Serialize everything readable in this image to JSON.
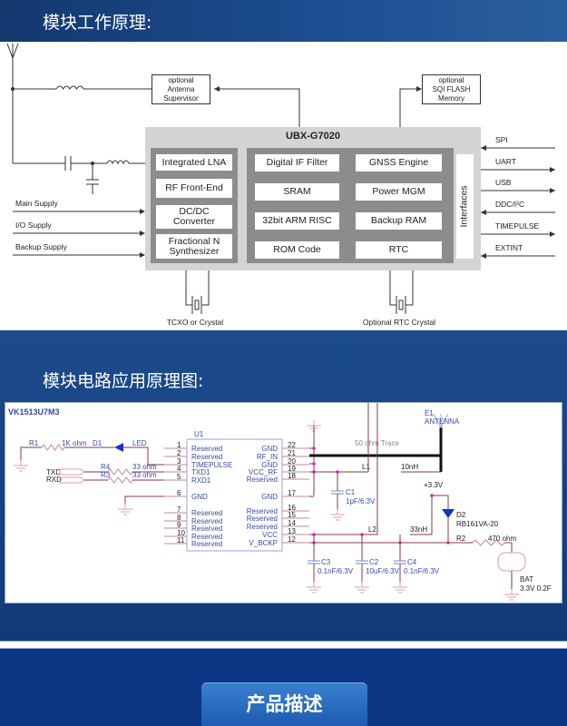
{
  "section1": {
    "title": "模块工作原理:"
  },
  "block_diagram": {
    "chip": "UBX-G7020",
    "antenna_supervisor": [
      "optional",
      "Antenna",
      "Supervisor"
    ],
    "flash": [
      "optional",
      "SQI FLASH",
      "Memory"
    ],
    "left_blocks": [
      "Integrated LNA",
      "RF Front-End",
      "DC/DC Converter",
      "Fractional N Synthesizer"
    ],
    "core_col1": [
      "Digital IF Filter",
      "SRAM",
      "32bit ARM RISC",
      "ROM Code"
    ],
    "core_col2": [
      "GNSS Engine",
      "Power MGM",
      "Backup RAM",
      "RTC"
    ],
    "interfaces": "Interfaces",
    "right_signals": [
      "SPI",
      "UART",
      "USB",
      "DDC/I²C",
      "TIMEPULSE",
      "EXTINT"
    ],
    "left_signals": [
      "Main Supply",
      "I/O Supply",
      "Backup Supply"
    ],
    "crystal1": "TCXO or Crystal",
    "crystal2": "Optional RTC Crystal"
  },
  "section2": {
    "title": "模块电路应用原理图:"
  },
  "schematic": {
    "title": "VK1513U7M3",
    "u1": "U1",
    "left_pins": [
      [
        "1",
        "Reserved"
      ],
      [
        "2",
        "Reserved"
      ],
      [
        "3",
        "TIMEPULSE"
      ],
      [
        "4",
        "TXD1"
      ],
      [
        "5",
        "RXD1"
      ],
      [
        "6",
        "GND"
      ],
      [
        "7",
        "Reserved"
      ],
      [
        "8",
        "Reserved"
      ],
      [
        "9",
        "Reserved"
      ],
      [
        "10",
        "Reserved"
      ],
      [
        "11",
        "Reserved"
      ]
    ],
    "right_pins": [
      [
        "22",
        "GND"
      ],
      [
        "21",
        "RF_IN"
      ],
      [
        "20",
        "GND"
      ],
      [
        "19",
        "VCC_RF"
      ],
      [
        "18",
        "Reserved"
      ],
      [
        "17",
        "GND"
      ],
      [
        "16",
        "Reserved"
      ],
      [
        "15",
        "Reserved"
      ],
      [
        "14",
        "Reserved"
      ],
      [
        "13",
        "VCC"
      ],
      [
        "12",
        "V_BCKP"
      ]
    ],
    "r1": "R1",
    "r1_val": "1K ohm",
    "d1": "D1",
    "led": "LED",
    "txd": "TXD",
    "rxd": "RXD",
    "r4": "R4",
    "r3": "R3",
    "r4_val": "33 ohm",
    "r3_val": "33 ohm",
    "e1": "E1",
    "antenna": "ANTENNA",
    "trace": "50 ohm Trace",
    "l1": "L1",
    "l1_val": "10nH",
    "c1": "C1",
    "c1_val": "1pF/6.3V",
    "vcc": "+3.3V",
    "d2": "D2",
    "d2_val": "RB161VA-20",
    "l2": "L2",
    "l2_val": "33nH",
    "r2": "R2",
    "r2_val": "470 ohm",
    "c3": "C3",
    "c3_val": "0.1nF/6.3V",
    "c2": "C2",
    "c2_val": "10uF/6.3V",
    "c4": "C4",
    "c4_val": "0.1nF/6.3V",
    "bat": "BAT",
    "bat_val": "3.3V  0.2F"
  },
  "section3": {
    "button": "产品描述"
  }
}
